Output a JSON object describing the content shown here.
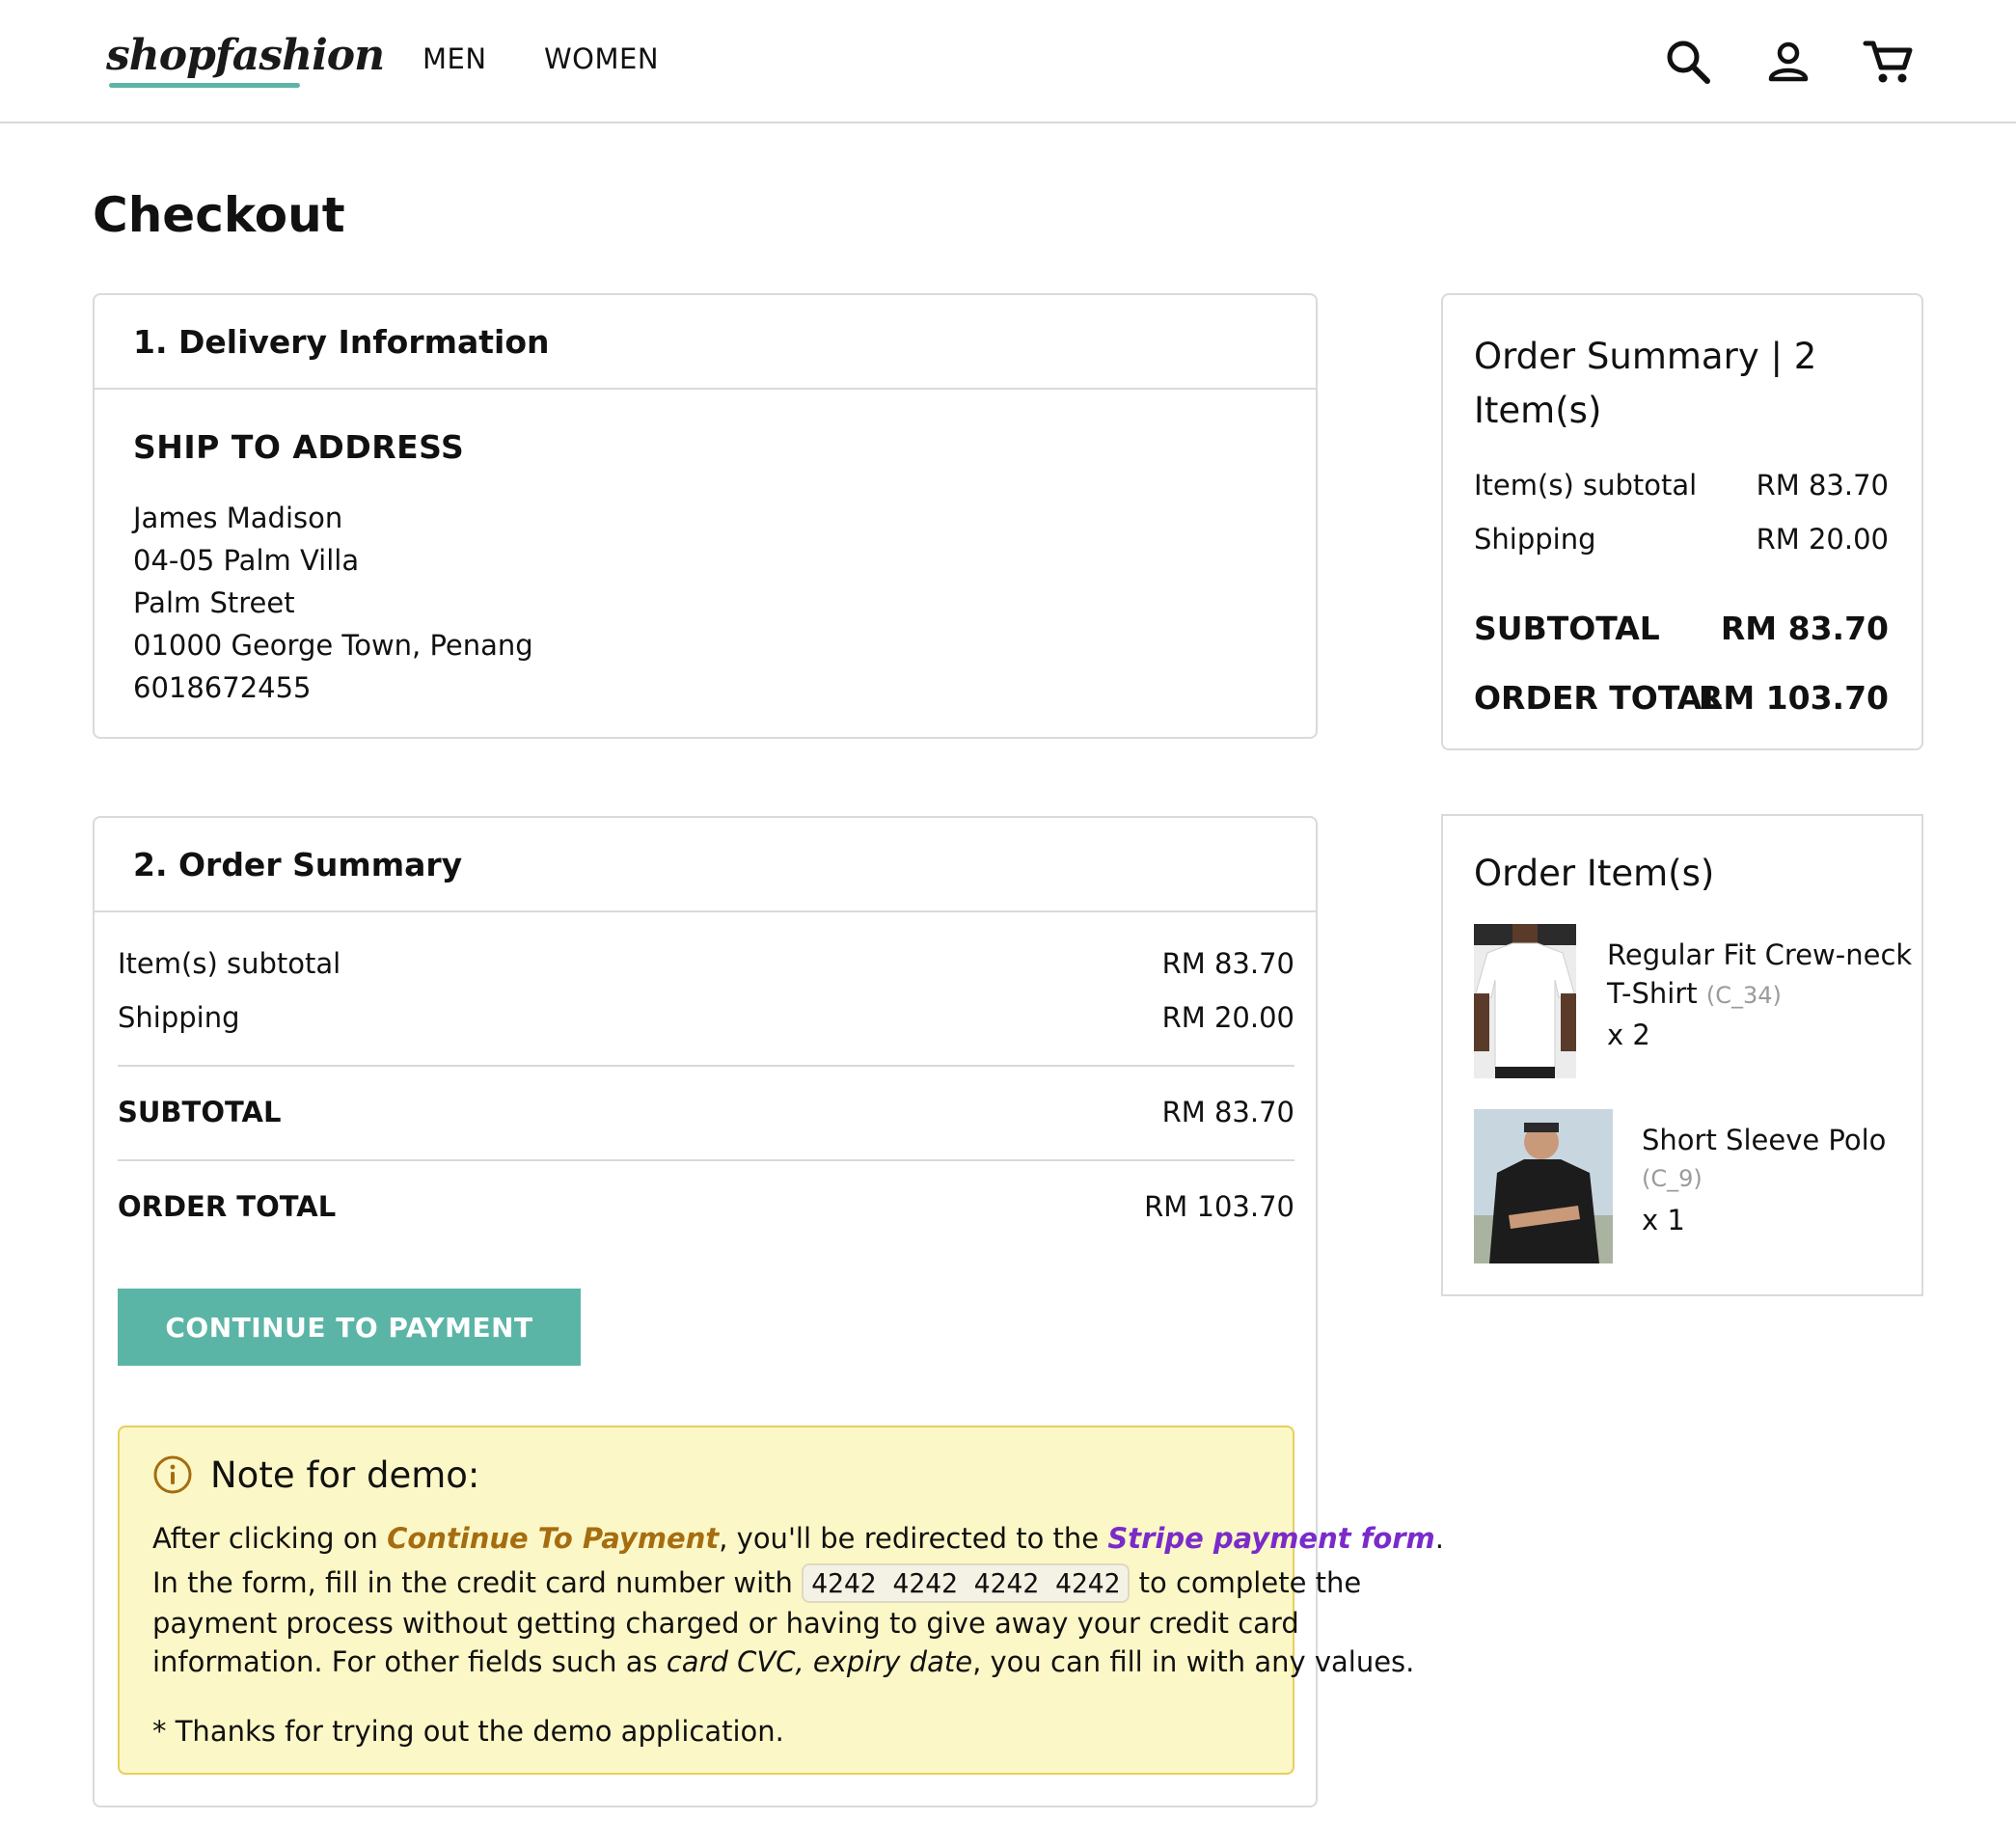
{
  "header": {
    "logo": "shopfashion",
    "nav": {
      "men": "MEN",
      "women": "WOMEN"
    },
    "icons": [
      "search-icon",
      "account-icon",
      "cart-icon"
    ]
  },
  "page_title": "Checkout",
  "delivery": {
    "heading": "1. Delivery Information",
    "ship_title": "SHIP TO ADDRESS",
    "address": {
      "name": "James Madison",
      "line1": "04-05 Palm Villa",
      "line2": "Palm Street",
      "city": "01000 George Town, Penang",
      "phone": "6018672455"
    }
  },
  "order_summary": {
    "heading": "2. Order Summary",
    "items_subtotal_label": "Item(s) subtotal",
    "items_subtotal_value": "RM 83.70",
    "shipping_label": "Shipping",
    "shipping_value": "RM 20.00",
    "subtotal_label": "SUBTOTAL",
    "subtotal_value": "RM 83.70",
    "order_total_label": "ORDER TOTAL",
    "order_total_value": "RM 103.70",
    "continue_button": "CONTINUE TO PAYMENT"
  },
  "note": {
    "title": "Note for demo:",
    "p1_a": "After clicking on ",
    "p1_b": "Continue To Payment",
    "p1_c": ", you'll be redirected to the ",
    "p1_d": "Stripe payment form",
    "p1_e": ".",
    "p2_a": "In the form, fill in the credit card number with ",
    "card_number": "4242 4242 4242 4242",
    "p2_b": " to complete the",
    "p3": "payment process without getting charged or having to give away your credit card",
    "p4_a": "information. For other fields such as ",
    "p4_b": "card CVC, expiry date",
    "p4_c": ", you can fill in with any values.",
    "thanks": "* Thanks for trying out the demo application."
  },
  "side_summary": {
    "title": "Order Summary | 2 Item(s)",
    "items_subtotal_label": "Item(s) subtotal",
    "items_subtotal_value": "RM 83.70",
    "shipping_label": "Shipping",
    "shipping_value": "RM 20.00",
    "subtotal_label": "SUBTOTAL",
    "subtotal_value": "RM 83.70",
    "order_total_label": "ORDER TOTAL",
    "order_total_value": "RM 103.70"
  },
  "order_items": {
    "title": "Order Item(s)",
    "items": [
      {
        "name_line1": "Regular Fit Crew-neck",
        "name_line2": "T-Shirt",
        "sku": "(C_34)",
        "qty": "x 2"
      },
      {
        "name_line1": "Short Sleeve Polo",
        "sku": "(C_9)",
        "qty": "x 1"
      }
    ]
  },
  "colors": {
    "accent": "#5bb5a6",
    "note_bg": "#fcf7c6",
    "note_border": "#e6cf5e",
    "link_brown": "#a56d10",
    "link_purple": "#7a2bc9"
  }
}
